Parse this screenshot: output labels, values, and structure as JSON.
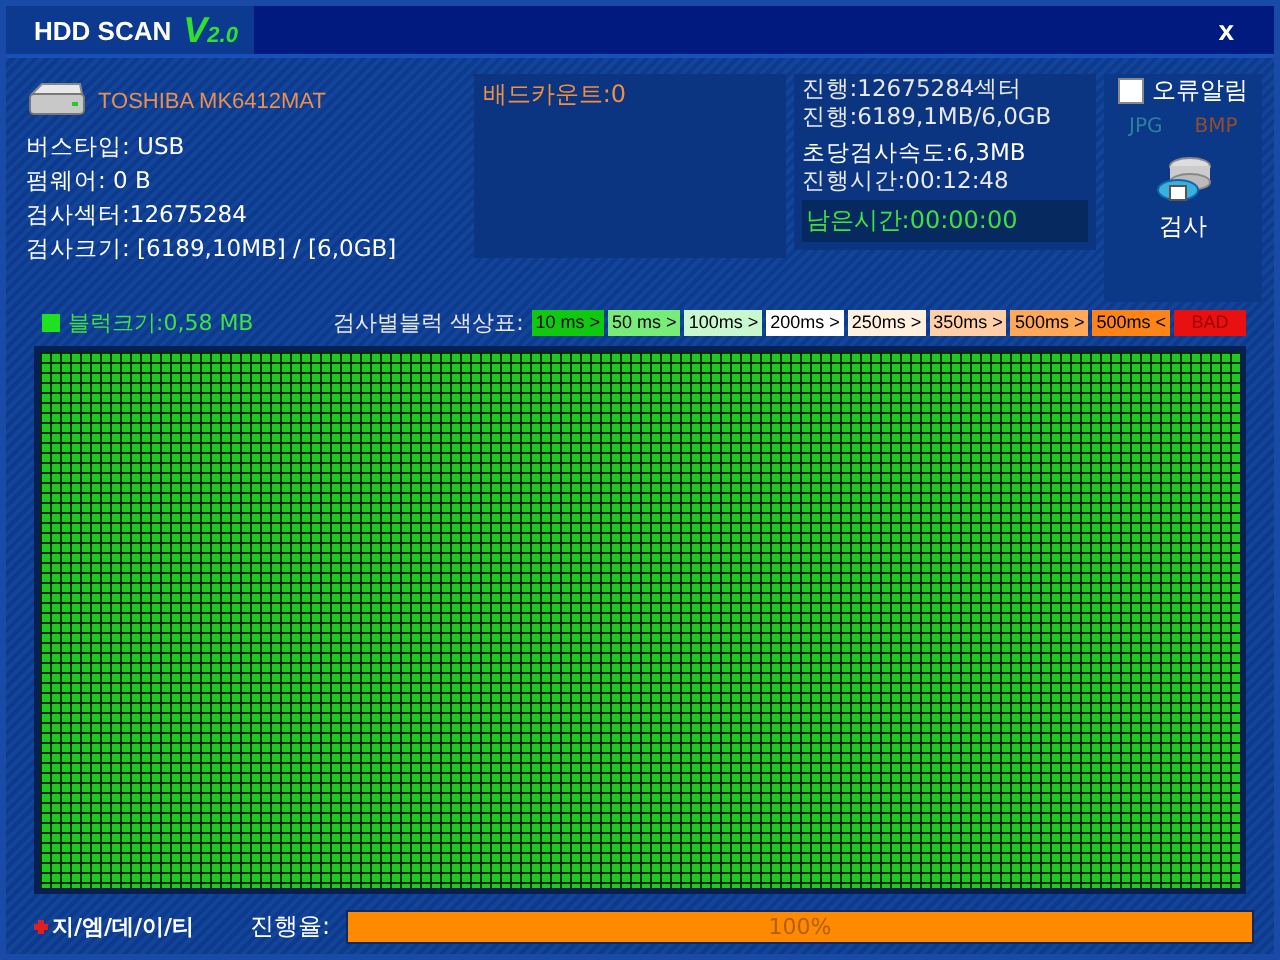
{
  "window": {
    "title": "HDD SCAN",
    "version": "V2.0",
    "close": "x"
  },
  "drive": {
    "model": "TOSHIBA MK6412MAT",
    "info": [
      "버스타입: USB",
      "펌웨어: 0 B",
      "검사섹터:12675284",
      "검사크기: [6189,10MB] / [6,0GB]"
    ]
  },
  "bad_count": "배드카운트:0",
  "progress_info": [
    "진행:12675284섹터",
    "진행:6189,1MB/6,0GB",
    "초당검사속도:6,3MB",
    "진행시간:00:12:48"
  ],
  "remaining": "남은시간:00:00:00",
  "error_alarm": {
    "label": "오류알림",
    "checked": false
  },
  "formats": [
    {
      "label": "JPG",
      "color": "#2f7f9f"
    },
    {
      "label": "BMP",
      "color": "#8f4f2f"
    }
  ],
  "scan_button": "검사",
  "block_size": "블럭크기:0,58 MB",
  "legend": {
    "title": "검사별블럭 색상표:",
    "items": [
      {
        "label": "10 ms >",
        "color": "#10c810"
      },
      {
        "label": "50 ms >",
        "color": "#78ec78"
      },
      {
        "label": "100ms >",
        "color": "#c8f8d0"
      },
      {
        "label": "200ms >",
        "color": "#ffffff"
      },
      {
        "label": "250ms >",
        "color": "#fff0e0"
      },
      {
        "label": "350ms >",
        "color": "#ffd0a8"
      },
      {
        "label": "500ms >",
        "color": "#ffa858"
      },
      {
        "label": "500ms <",
        "color": "#ff8418"
      },
      {
        "label": "BAD",
        "color": "#e81010"
      }
    ]
  },
  "footer": {
    "brand": "지/엠/데/이/티",
    "progress_label": "진행율:",
    "progress": {
      "level": 1,
      "text": "100%"
    }
  }
}
